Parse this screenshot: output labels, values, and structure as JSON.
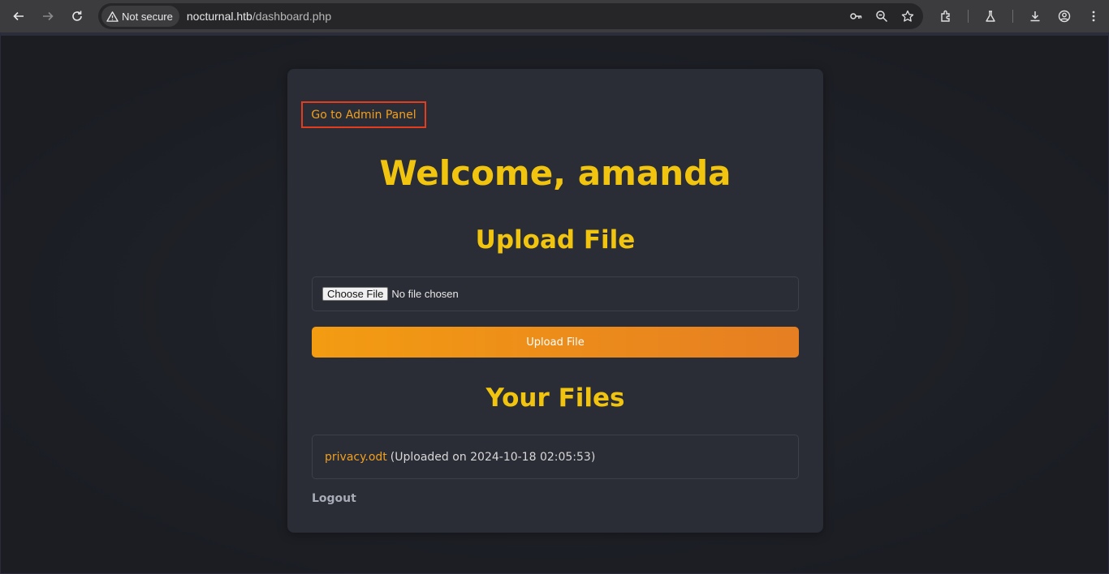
{
  "browser": {
    "security_label": "Not secure",
    "url_host": "nocturnal.htb",
    "url_path": "/dashboard.php",
    "icons": [
      "back-icon",
      "forward-icon",
      "reload-icon",
      "warning-icon",
      "key-icon",
      "zoom-icon",
      "star-icon",
      "extensions-icon",
      "labs-icon",
      "download-icon",
      "profile-icon",
      "menu-icon"
    ]
  },
  "page": {
    "admin_link": "Go to Admin Panel",
    "welcome": "Welcome, amanda",
    "upload_title": "Upload File",
    "file_input": {
      "button_label": "Choose File",
      "status": "No file chosen"
    },
    "upload_button": "Upload File",
    "files_title": "Your Files",
    "files": [
      {
        "name": "privacy.odt",
        "meta": "(Uploaded on 2024-10-18 02:05:53)"
      }
    ],
    "logout": "Logout"
  },
  "colors": {
    "accent": "#f1c40f",
    "link": "#f0a020",
    "highlight_border": "#e23d1e",
    "card_bg": "#2a2c36"
  }
}
